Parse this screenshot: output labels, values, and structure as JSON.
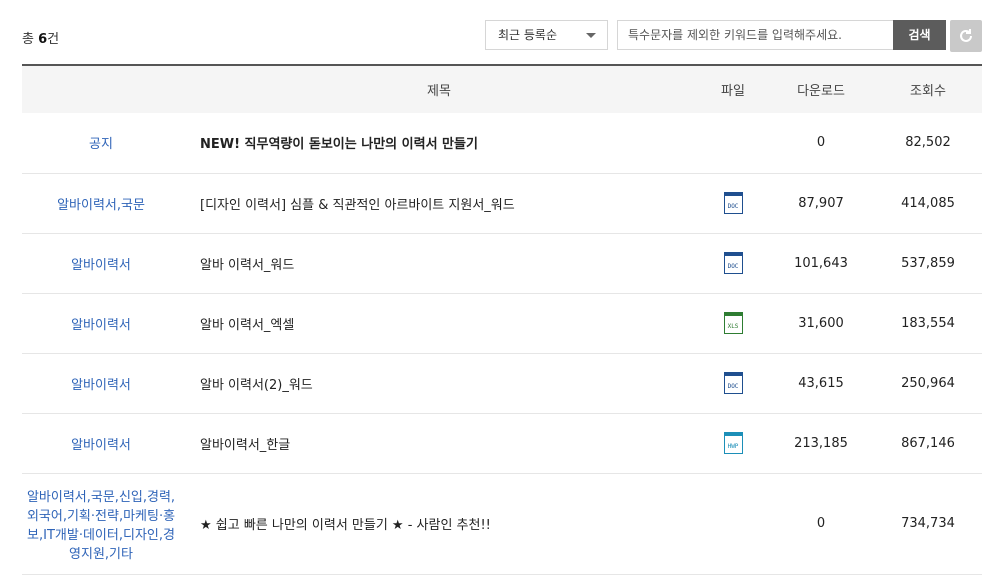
{
  "summary": {
    "total_prefix": "총 ",
    "total_count": "6",
    "total_suffix": "건"
  },
  "sort": {
    "selected": "최근 등록순"
  },
  "search": {
    "placeholder": "특수문자를 제외한 키워드를 입력해주세요.",
    "button_label": "검색"
  },
  "columns": {
    "title": "제목",
    "file": "파일",
    "downloads": "다운로드",
    "views": "조회수"
  },
  "rows": [
    {
      "category": "공지",
      "title": "NEW! 직무역량이 돋보이는 나만의 이력서 만들기",
      "file": "",
      "file_label": "",
      "downloads": "0",
      "views": "82,502"
    },
    {
      "category": "알바이력서,국문",
      "title": "[디자인 이력서] 심플 & 직관적인 아르바이트 지원서_워드",
      "file": "doc",
      "file_label": "DOC",
      "downloads": "87,907",
      "views": "414,085"
    },
    {
      "category": "알바이력서",
      "title": "알바 이력서_워드",
      "file": "doc",
      "file_label": "DOC",
      "downloads": "101,643",
      "views": "537,859"
    },
    {
      "category": "알바이력서",
      "title": "알바 이력서_엑셀",
      "file": "xls",
      "file_label": "XLS",
      "downloads": "31,600",
      "views": "183,554"
    },
    {
      "category": "알바이력서",
      "title": "알바 이력서(2)_워드",
      "file": "doc",
      "file_label": "DOC",
      "downloads": "43,615",
      "views": "250,964"
    },
    {
      "category": "알바이력서",
      "title": "알바이력서_한글",
      "file": "hwp",
      "file_label": "HWP",
      "downloads": "213,185",
      "views": "867,146"
    },
    {
      "category": "알바이력서,국문,신입,경력,외국어,기획·전략,마케팅·홍보,IT개발·데이터,디자인,경영지원,기타",
      "title": "★ 쉽고 빠른 나만의 이력서 만들기 ★ - 사람인 추천!!",
      "file": "",
      "file_label": "",
      "downloads": "0",
      "views": "734,734"
    }
  ],
  "colors": {
    "accent_link": "#2f64b8",
    "search_button": "#5c5c5c",
    "doc": "#1f4f8f",
    "xls": "#2e7d32",
    "hwp": "#1c8fb8"
  },
  "icons": {
    "reset": "refresh-icon",
    "sort": "chevron-down-icon"
  }
}
